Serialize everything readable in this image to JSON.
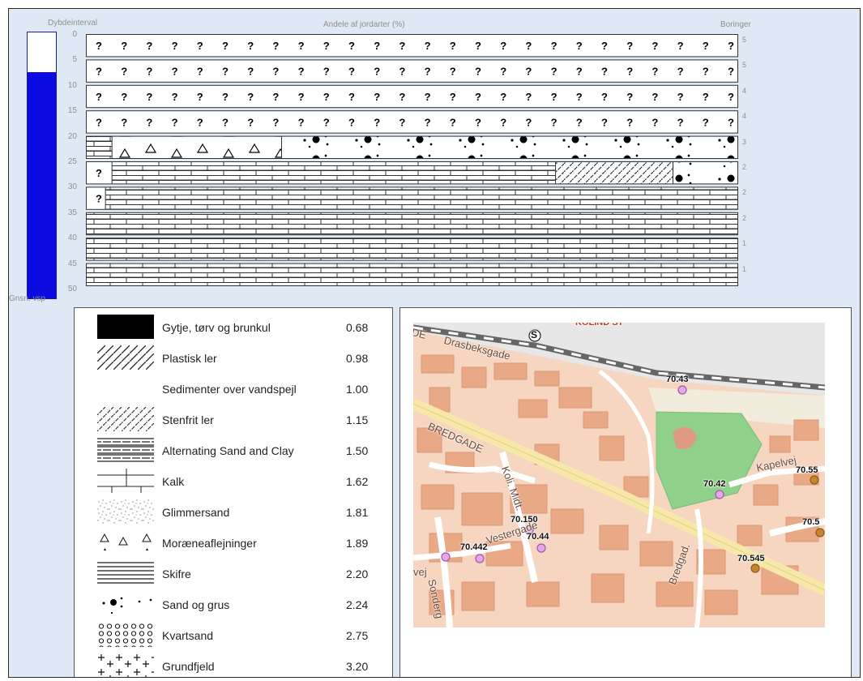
{
  "header": {
    "depth_label": "Dybdeinterval",
    "shares_label": "Andele af jordarter (%)",
    "borings_label": "Boringer"
  },
  "gauge": {
    "value": "7.5",
    "fraction": 0.85,
    "label": "Gnsn. vsp",
    "color": "#0b0be0"
  },
  "depth_ticks": [
    "0",
    "5",
    "10",
    "15",
    "20",
    "25",
    "30",
    "35",
    "40",
    "45",
    "50"
  ],
  "boring_counts": [
    "5",
    "5",
    "4",
    "4",
    "3",
    "2",
    "2",
    "2",
    "1",
    "1"
  ],
  "profile_rows": [
    {
      "segments": [
        [
          "unknown",
          1.0
        ]
      ]
    },
    {
      "segments": [
        [
          "unknown",
          1.0
        ]
      ]
    },
    {
      "segments": [
        [
          "unknown",
          1.0
        ]
      ]
    },
    {
      "segments": [
        [
          "unknown",
          1.0
        ]
      ]
    },
    {
      "segments": [
        [
          "kalk",
          0.04
        ],
        [
          "moraene",
          0.26
        ],
        [
          "sand",
          0.7
        ]
      ]
    },
    {
      "segments": [
        [
          "unknown",
          0.04
        ],
        [
          "kalk",
          0.68
        ],
        [
          "stenfri",
          0.18
        ],
        [
          "sand",
          0.1
        ]
      ]
    },
    {
      "segments": [
        [
          "unknown",
          0.03
        ],
        [
          "kalk",
          0.97
        ]
      ]
    },
    {
      "segments": [
        [
          "kalk",
          1.0
        ]
      ]
    },
    {
      "segments": [
        [
          "kalk",
          1.0
        ]
      ]
    },
    {
      "segments": [
        [
          "kalk",
          1.0
        ]
      ]
    }
  ],
  "profile_unknown_mark": "?",
  "legend": [
    {
      "name": "Gytje, tørv og brunkul",
      "value": "0.68",
      "pattern": "gytje"
    },
    {
      "name": "Plastisk ler",
      "value": "0.98",
      "pattern": "plastisk"
    },
    {
      "name": "Sedimenter over vandspejl",
      "value": "1.00",
      "pattern": "none"
    },
    {
      "name": "Stenfrit ler",
      "value": "1.15",
      "pattern": "stenfri"
    },
    {
      "name": "Alternating Sand and Clay",
      "value": "1.50",
      "pattern": "alternating"
    },
    {
      "name": "Kalk",
      "value": "1.62",
      "pattern": "kalk"
    },
    {
      "name": "Glimmersand",
      "value": "1.81",
      "pattern": "glimmer"
    },
    {
      "name": "Moræneaflejninger",
      "value": "1.89",
      "pattern": "moraene"
    },
    {
      "name": "Skifre",
      "value": "2.20",
      "pattern": "skifre"
    },
    {
      "name": "Sand og grus",
      "value": "2.24",
      "pattern": "sand"
    },
    {
      "name": "Kvartsand",
      "value": "2.75",
      "pattern": "kvarts"
    },
    {
      "name": "Grundfjeld",
      "value": "3.20",
      "pattern": "grundfjeld"
    }
  ],
  "map": {
    "station_symbol": "S",
    "station_text": "KOLIND ST",
    "streets": {
      "drasbeksgade": "Drasbeksgade",
      "bredgade": "BREDGADE",
      "koli_mid": "Koli. Midt.",
      "vestergade": "Vestergade",
      "kapelvej": "Kapelvej",
      "bredgad": "Bredgad.",
      "sonder": "Sonderg",
      "vej": "vej",
      "de": "DE"
    },
    "markers": [
      {
        "label": "70.43",
        "color": "pink"
      },
      {
        "label": "70.42",
        "color": "pink"
      },
      {
        "label": "70.55",
        "color": "brown"
      },
      {
        "label": "70.150",
        "color": "pink"
      },
      {
        "label": "70.44",
        "color": "pink"
      },
      {
        "label": "70.442",
        "color": "pink"
      },
      {
        "label": "",
        "color": "pink"
      },
      {
        "label": "70.545",
        "color": "brown"
      },
      {
        "label": "70.5",
        "color": "brown"
      }
    ]
  }
}
